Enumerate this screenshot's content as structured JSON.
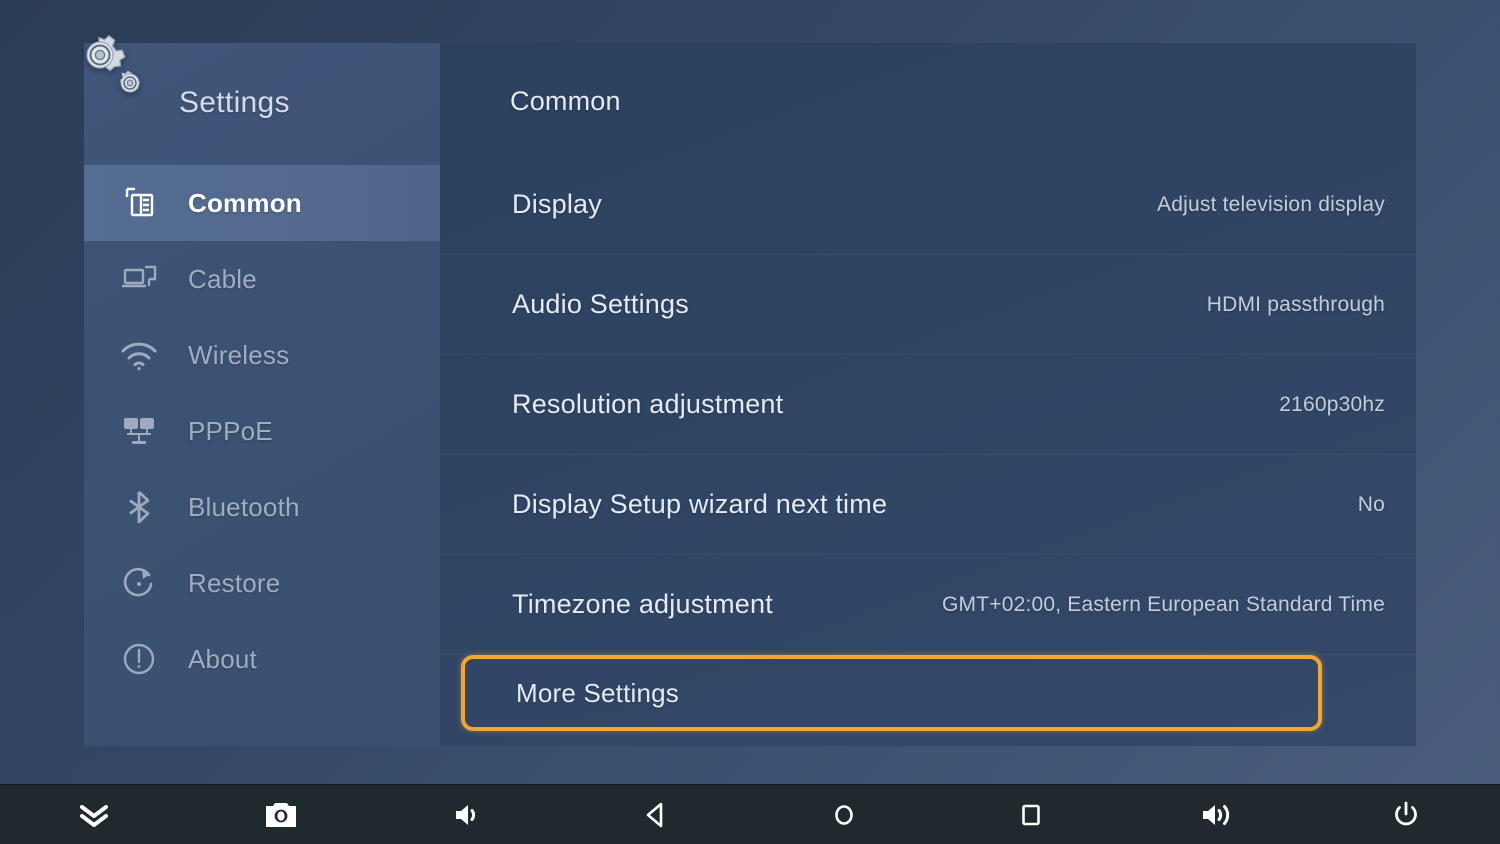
{
  "app": {
    "logo_icon": "gears-icon",
    "sidebar_title": "Settings"
  },
  "sidebar": {
    "items": [
      {
        "label": "Common",
        "icon": "common-window-icon",
        "active": true
      },
      {
        "label": "Cable",
        "icon": "ethernet-cable-icon",
        "active": false
      },
      {
        "label": "Wireless",
        "icon": "wifi-icon",
        "active": false
      },
      {
        "label": "PPPoE",
        "icon": "pppoe-network-icon",
        "active": false
      },
      {
        "label": "Bluetooth",
        "icon": "bluetooth-icon",
        "active": false
      },
      {
        "label": "Restore",
        "icon": "restore-refresh-icon",
        "active": false
      },
      {
        "label": "About",
        "icon": "info-circle-icon",
        "active": false
      }
    ]
  },
  "content": {
    "title": "Common",
    "rows": [
      {
        "label": "Display",
        "value": "Adjust television display"
      },
      {
        "label": "Audio Settings",
        "value": "HDMI passthrough"
      },
      {
        "label": "Resolution adjustment",
        "value": "2160p30hz"
      },
      {
        "label": "Display Setup wizard next time",
        "value": "No"
      },
      {
        "label": "Timezone adjustment",
        "value": "GMT+02:00, Eastern European Standard Time"
      }
    ],
    "focused_row": {
      "label": "More Settings",
      "value": ""
    }
  },
  "bottom_bar": {
    "buttons": [
      {
        "icon": "double-chevron-down-icon",
        "name": "hide-bar-button"
      },
      {
        "icon": "camera-icon",
        "name": "screenshot-button"
      },
      {
        "icon": "volume-down-icon",
        "name": "volume-down-button"
      },
      {
        "icon": "back-triangle-icon",
        "name": "back-button"
      },
      {
        "icon": "home-circle-icon",
        "name": "home-button"
      },
      {
        "icon": "recents-square-icon",
        "name": "recents-button"
      },
      {
        "icon": "volume-up-icon",
        "name": "volume-up-button"
      },
      {
        "icon": "power-icon",
        "name": "power-button"
      }
    ]
  },
  "colors": {
    "accent_focus": "#f0a830",
    "sidebar_bg": "#3c5274",
    "content_bg": "#2f4463",
    "active_item_bg": "#53698d",
    "bottom_bar_bg": "#20292e",
    "text_primary": "#e6ebf3",
    "text_secondary": "#9fadc0"
  }
}
